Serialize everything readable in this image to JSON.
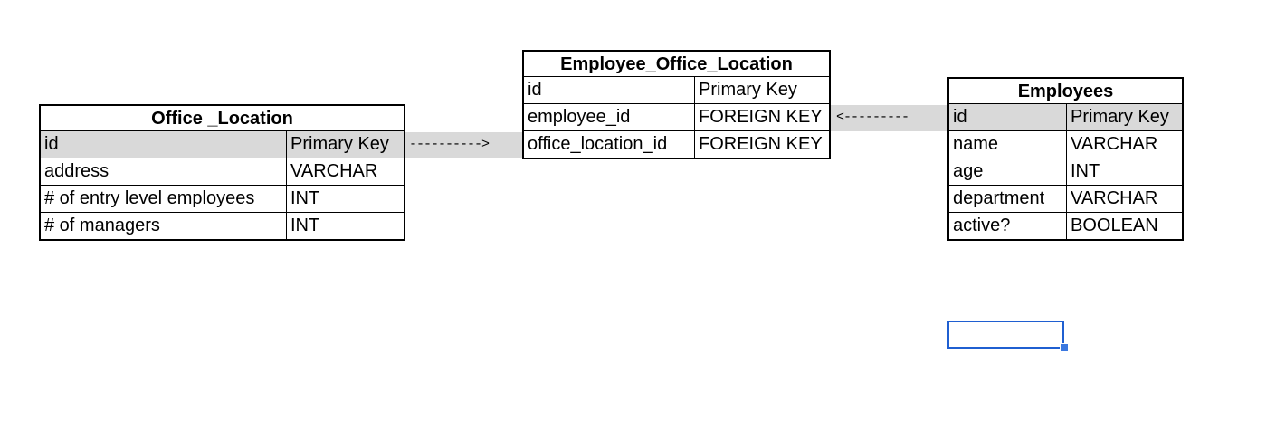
{
  "tables": {
    "office_location": {
      "title": "Office _Location",
      "rows": [
        [
          "id",
          "Primary Key"
        ],
        [
          "address",
          "VARCHAR"
        ],
        [
          "# of entry level employees",
          "INT"
        ],
        [
          "# of managers",
          "INT"
        ]
      ]
    },
    "employee_office_location": {
      "title": "Employee_Office_Location",
      "rows": [
        [
          "id",
          "Primary Key"
        ],
        [
          "employee_id",
          "FOREIGN KEY"
        ],
        [
          "office_location_id",
          "FOREIGN KEY"
        ]
      ]
    },
    "employees": {
      "title": "Employees",
      "rows": [
        [
          "id",
          "Primary Key"
        ],
        [
          "name",
          "VARCHAR"
        ],
        [
          "age",
          "INT"
        ],
        [
          "department",
          "VARCHAR"
        ],
        [
          "active?",
          "BOOLEAN"
        ]
      ]
    }
  },
  "arrows": {
    "office_to_join": "---------->",
    "employees_to_join": "<---------"
  },
  "colors": {
    "highlight": "#d9d9d9",
    "selection": "#1f5fd1"
  }
}
